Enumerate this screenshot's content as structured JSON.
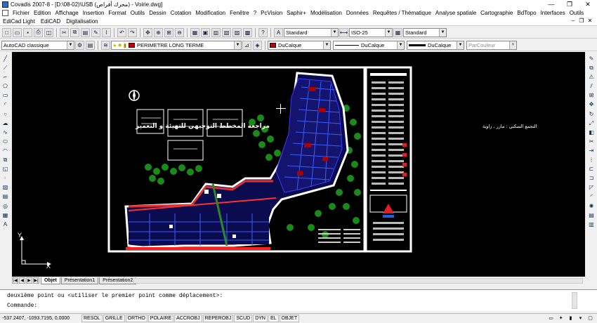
{
  "titlebar": {
    "title": "Covadis 2007-8 - [D:\\08-02)\\USB (محرك أقراص) - Voirie.dwg]",
    "minimize": "—",
    "restore": "❐",
    "close": "✕"
  },
  "menu": {
    "items": [
      "Fichier",
      "Edition",
      "Affichage",
      "Insertion",
      "Format",
      "Outils",
      "Dessin",
      "Cotation",
      "Modification",
      "Fenêtre",
      "?",
      "PcVision",
      "Saphir+",
      "Modélisation",
      "Données",
      "Requêtes / Thématique",
      "Analyse spatiale",
      "Cartographie",
      "BdTopo",
      "Interfaces",
      "Outils"
    ],
    "row2": [
      "EdiCad Light",
      "EdiCAD",
      "Digitalisation"
    ],
    "mdi_minimize": "–",
    "mdi_restore": "❐",
    "mdi_close": "✕"
  },
  "toolbar1": {
    "text_style": "Standard",
    "dim_style": "ISO-25",
    "table_style": "Standard"
  },
  "toolbar2": {
    "workspace": "AutoCAD classique",
    "layer": "PERIMETRE LONG TERME",
    "color": "DuCalque",
    "linetype": "DuCalque",
    "lineweight": "DuCalque",
    "plotstyle": "ParCouleur"
  },
  "drawing": {
    "title_text": "مراجعة المخطط التوجيهي للتهيئة و التعمير",
    "side_label": "التجمع السكني : مازر ، زاوية",
    "ucs_x": "X",
    "ucs_y": "Y"
  },
  "tabs": [
    "Objet",
    "Présentation1",
    "Présentation2"
  ],
  "command": {
    "line1": "deuxième point ou <utiliser le premier point comme déplacement>:",
    "line2": "Commande:"
  },
  "status": {
    "coords": "-537.2407, -1093.7195, 0.0000",
    "buttons": [
      "RESOL",
      "GRILLE",
      "ORTHO",
      "POLAIRE",
      "ACCROBJ",
      "REPEROBJ",
      "SCUD",
      "DYN",
      "EL",
      "OBJET"
    ]
  },
  "colors": {
    "model_space": "#000000",
    "sheet": "#ffffff",
    "layer_color": "#c00000"
  }
}
